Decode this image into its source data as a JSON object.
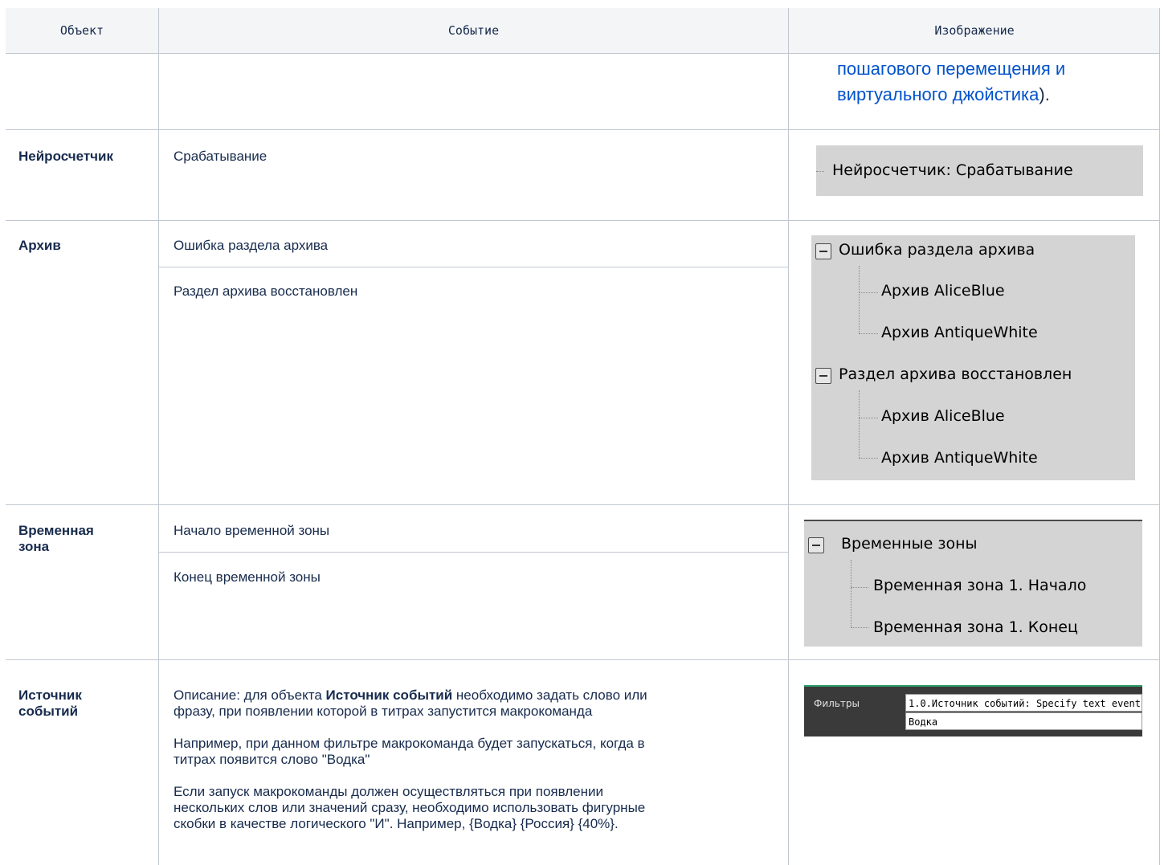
{
  "header": {
    "col_object": "Объект",
    "col_event": "Событие",
    "col_image": "Изображение"
  },
  "row0": {
    "link_line1": "пошагового перемещения и",
    "link_line2": "виртуального джойстика",
    "tail": ")."
  },
  "row_neuro": {
    "object": "Нейросчетчик",
    "event": "Срабатывание",
    "image_text": "Нейросчетчик: Срабатывание"
  },
  "row_archive": {
    "object": "Архив",
    "events": [
      "Ошибка раздела архива",
      "Раздел архива восстановлен"
    ],
    "tree": {
      "group1": "Ошибка раздела архива",
      "g1_item1": "Архив AliceBlue",
      "g1_item2": "Архив AntiqueWhite",
      "group2": "Раздел архива восстановлен",
      "g2_item1": "Архив AliceBlue",
      "g2_item2": "Архив AntiqueWhite"
    }
  },
  "row_timezone": {
    "object_line1": "Временная",
    "object_line2": "зона",
    "events": [
      "Начало временной зоны",
      "Конец временной зоны"
    ],
    "tree": {
      "group": "Временные зоны",
      "item1": "Временная зона 1. Начало",
      "item2": "Временная зона 1. Конец"
    }
  },
  "row_source": {
    "object_line1": "Источник",
    "object_line2": "событий",
    "p1_line1_pre": "Описание: для объекта ",
    "p1_bold": "Источник событий",
    "p1_line1_post": " необходимо задать слово или",
    "p1_line2": "фразу, при появлении которой в титрах запустится макрокоманда",
    "p2_line1": "Например, при данном фильтре макрокоманда будет запускаться, когда в",
    "p2_line2": "титрах появится слово \"Водка\"",
    "p3_line1": "Если запуск макрокоманды должен осуществляться при появлении",
    "p3_line2": "нескольких слов или значений сразу, необходимо использовать фигурные",
    "p3_line3": "скобки в качестве логического \"И\". Например, {Водка} {Россия} {40%}.",
    "filter": {
      "label": "Фильтры",
      "value1": "1.0.Источник событий: Specify text event",
      "value2": "Водка"
    }
  }
}
